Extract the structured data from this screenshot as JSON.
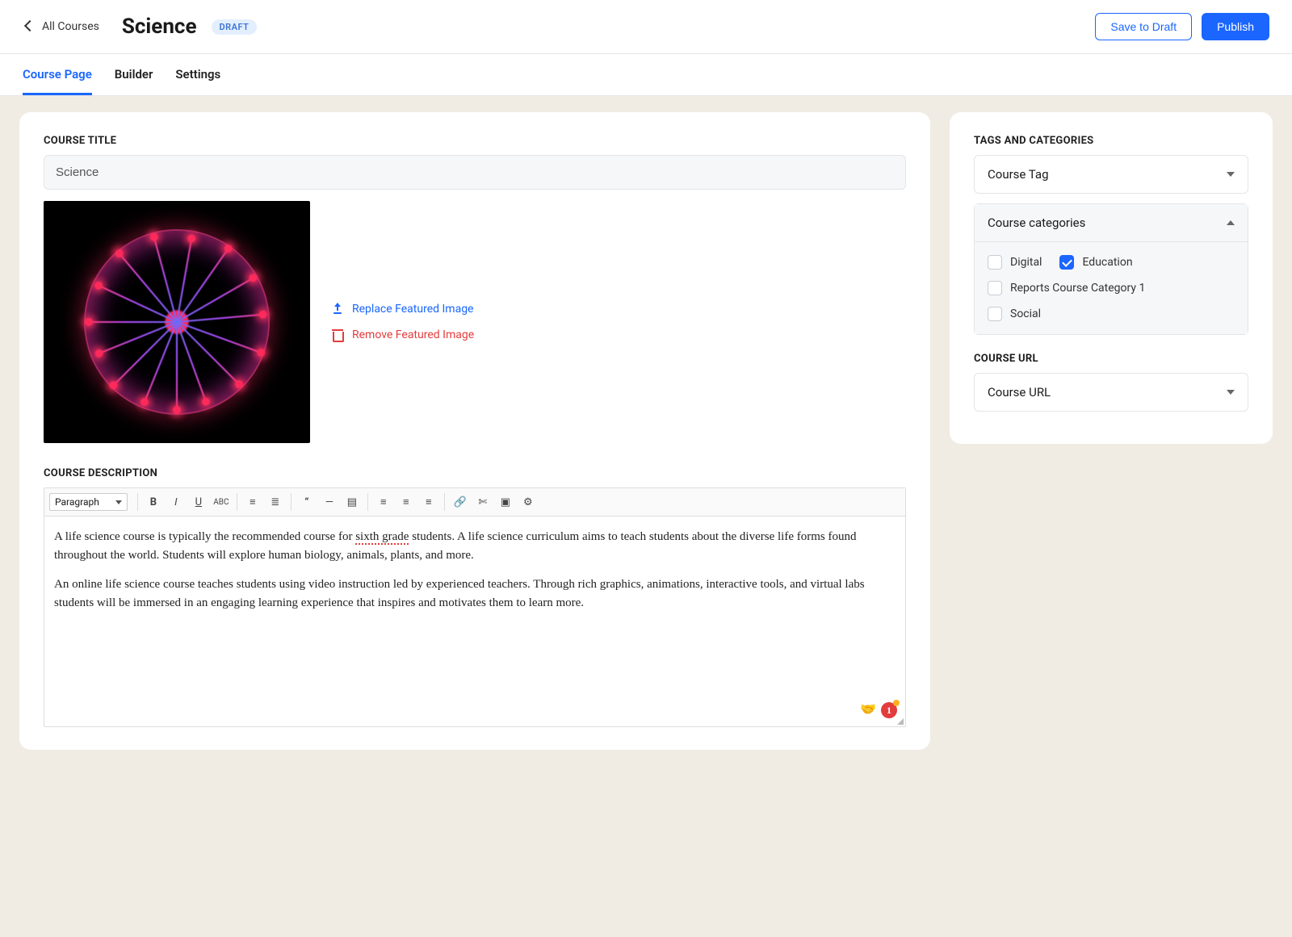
{
  "header": {
    "back_label": "All Courses",
    "title": "Science",
    "badge": "DRAFT",
    "save_draft": "Save to Draft",
    "publish": "Publish"
  },
  "tabs": [
    {
      "label": "Course Page",
      "active": true
    },
    {
      "label": "Builder",
      "active": false
    },
    {
      "label": "Settings",
      "active": false
    }
  ],
  "main": {
    "title_section_label": "COURSE TITLE",
    "title_value": "Science",
    "replace_image": "Replace Featured Image",
    "remove_image": "Remove Featured Image",
    "desc_section_label": "COURSE DESCRIPTION",
    "toolbar": {
      "block_format": "Paragraph"
    },
    "description_p1_a": "A life science course is typically the recommended course for ",
    "description_p1_squiggle": "sixth grade",
    "description_p1_b": " students. A life science curriculum aims to teach students about the diverse life forms found throughout the world. Students will explore human biology, animals, plants, and more.",
    "description_p2": "An online life science course teaches students using video instruction led by experienced teachers. Through rich graphics, animations, interactive tools, and virtual labs students will be immersed in an engaging learning experience that inspires and motivates them to learn more.",
    "grammar_badge": "1"
  },
  "sidebar": {
    "tags_label": "TAGS AND CATEGORIES",
    "course_tag_label": "Course Tag",
    "course_categories_label": "Course categories",
    "categories": [
      {
        "label": "Digital",
        "checked": false
      },
      {
        "label": "Education",
        "checked": true
      },
      {
        "label": "Reports Course Category 1",
        "checked": false
      },
      {
        "label": "Social",
        "checked": false
      }
    ],
    "url_label": "COURSE URL",
    "course_url_header": "Course URL"
  }
}
